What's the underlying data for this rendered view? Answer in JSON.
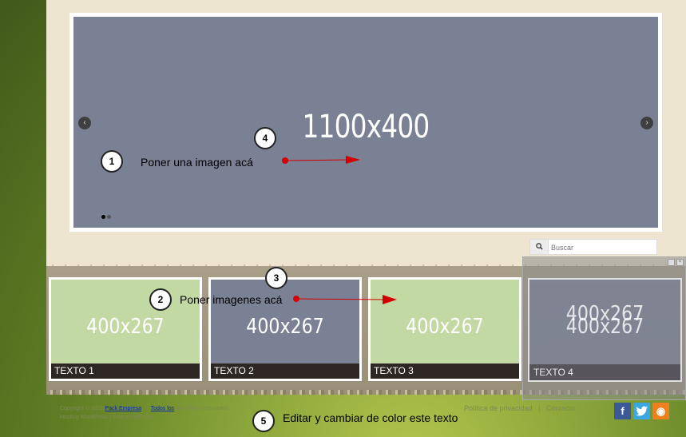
{
  "slider": {
    "size_label": "1100x400",
    "prev_icon": "‹",
    "next_icon": "›"
  },
  "search": {
    "placeholder": "Buscar",
    "icon": "search-icon"
  },
  "cards": [
    {
      "size": "400x267",
      "caption": "TEXTO 1",
      "color": "#c2d9a3"
    },
    {
      "size": "400x267",
      "caption": "TEXTO 2",
      "color": "#7b8194"
    },
    {
      "size": "400x267",
      "caption": "TEXTO 3",
      "color": "#c2d9a3"
    },
    {
      "size": "400x267",
      "caption": "TEXTO 4",
      "color": "#7b8194"
    }
  ],
  "footer": {
    "copyright_prefix": "Copyright © 2015",
    "company_link": "Pack Empresa",
    "rights_link": "Todos los",
    "rights_suffix": "derechos reservados",
    "hosting": "Hosting WordPress | Web WordPress",
    "privacy": "Política de privacidad",
    "separator": "|",
    "contact": "Contacto"
  },
  "social": {
    "facebook": "f",
    "rss": "◉"
  },
  "annotations": {
    "badge_1": "1",
    "badge_2": "2",
    "badge_3": "3",
    "badge_4": "4",
    "badge_5": "5",
    "note_1": "Poner una imagen acá",
    "note_2": "Poner imagenes acá",
    "note_5": "Editar y cambiar de color este texto",
    "arrow_color": "#d40000"
  }
}
